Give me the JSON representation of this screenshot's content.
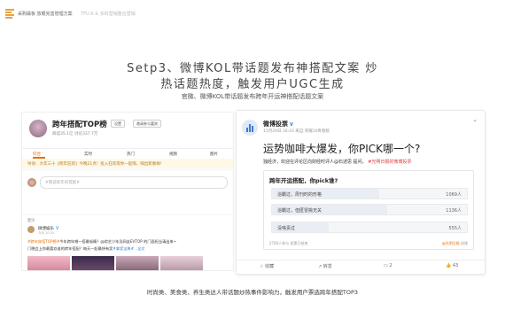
{
  "header": {
    "logo_icon": "stacked-lines-logo",
    "breadcrumb": "采购磁板 放眼完善管理方案",
    "breadcrumb_extra": "TFU.K & 多科营销整合营销"
  },
  "main_title_line1": "Setp3、微博KOL带话题发布神搭配文案 炒",
  "main_title_line2": "热话题热度，触发用户UGC生成",
  "subtitle": "官微、微博KOL带话题发布跨年开运神搭配话题文案",
  "left_panel": {
    "page_name": "跨年搭配TOP榜",
    "buttons": [
      "设置",
      "邀请参与嘉宾"
    ],
    "stats": "阅读35.1亿  讨论337.7万",
    "tabs": [
      "综合",
      "实时",
      "热门",
      "视频",
      "图片"
    ],
    "active_tab": "综合",
    "banner": "导语：大年三十《跨年狂欢》今晚21点！投入狂欢等你一起嗨，嗨出新春样！",
    "comment_placeholder": "#我说新年的搭配#",
    "hot_section_label": "置顶",
    "hot_user": "微博娱乐",
    "hot_time": "今天 10:20",
    "hot_line1_prefix": "#跨年穿搭",
    "hot_line1_text": "TOP榜#",
    "hot_line1_rest": "今年跨年哪一搭最吸睛？@综艺少年及网友EVTOP 的门面担当请出来~",
    "hot_line2_prefix": "门晚",
    "hot_line2_text": "会上你最喜欢谁的跨年搭配？每天一起最快有奖",
    "hot_line2_link": "#拿奖宝典#",
    "hot_line2_rest": "...全文"
  },
  "right_panel": {
    "account_name": "微博投票",
    "verified_icon": "verified-v-icon",
    "account_meta": "11月29日 16:43 来自 荣耀10青春版",
    "chevron_icon": "chevron-down-icon",
    "headline": "运势咖啡大爆发，你PICK哪一个?",
    "intro_plain": "独经济，欢迎在评论区向财经时评人@石述思 提问。",
    "intro_red": "#光明日报的微博投票",
    "poll": {
      "question": "跨年开运搭配，你pick谁?",
      "options": [
        {
          "label": "浴霸过，周刊时的形格",
          "votes": "1069人",
          "pct": 0.55
        },
        {
          "label": "浴霸过，但匿冒挑无关",
          "votes": "1136人",
          "pct": 0.59
        },
        {
          "label": "没啥责过",
          "votes": "555人",
          "pct": 0.29
        }
      ],
      "footer_left": "2760人参与  投票已结束",
      "footer_right_red": "@光明日报",
      "footer_right": "创建"
    },
    "actions": [
      "收藏",
      "转发",
      "2",
      "43"
    ],
    "action_icons": [
      "star-icon",
      "share-icon",
      "comment-icon",
      "like-icon"
    ]
  },
  "caption": "时尚类、美食类、养生类达人带话题炒热事件影响力，触发用户票选跨年搭配TOP3",
  "colors": {
    "accent_orange": "#e86c00",
    "link_blue": "#2a7de1",
    "poll_red": "#e03c3c"
  }
}
